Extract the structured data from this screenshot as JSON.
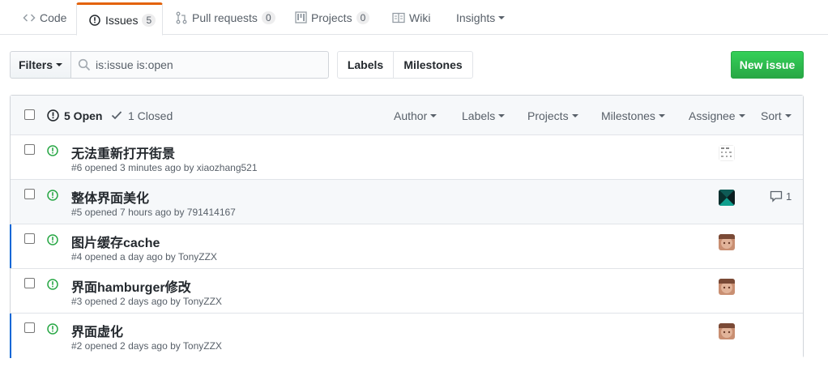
{
  "tabs": [
    {
      "label": "Code",
      "icon": "code-icon"
    },
    {
      "label": "Issues",
      "icon": "issue-opened-icon",
      "count": "5"
    },
    {
      "label": "Pull requests",
      "icon": "git-pull-request-icon",
      "count": "0"
    },
    {
      "label": "Projects",
      "icon": "project-icon",
      "count": "0"
    },
    {
      "label": "Wiki",
      "icon": "book-icon"
    },
    {
      "label": "Insights",
      "icon": "caret-down-icon"
    }
  ],
  "subnav": {
    "filters_label": "Filters",
    "search_value": "is:issue is:open",
    "labels_label": "Labels",
    "milestones_label": "Milestones",
    "new_issue_label": "New issue"
  },
  "header": {
    "open_label": "5 Open",
    "closed_label": "1 Closed",
    "menus": [
      "Author",
      "Labels",
      "Projects",
      "Milestones",
      "Assignee",
      "Sort"
    ]
  },
  "issues": [
    {
      "title": "无法重新打开街景",
      "meta": "#6 opened 3 minutes ago by xiaozhang521",
      "comments": ""
    },
    {
      "title": "整体界面美化",
      "meta": "#5 opened 7 hours ago by 791414167",
      "comments": "1"
    },
    {
      "title": "图片缓存cache",
      "meta": "#4 opened a day ago by TonyZZX",
      "comments": ""
    },
    {
      "title": "界面hamburger修改",
      "meta": "#3 opened 2 days ago by TonyZZX",
      "comments": ""
    },
    {
      "title": "界面虚化",
      "meta": "#2 opened 2 days ago by TonyZZX",
      "comments": ""
    }
  ],
  "colors": {
    "open_green": "#28a745",
    "selected_tab_accent": "#e36209",
    "new_issue_bg": "#28a745",
    "row_marker": "#0366d6"
  }
}
